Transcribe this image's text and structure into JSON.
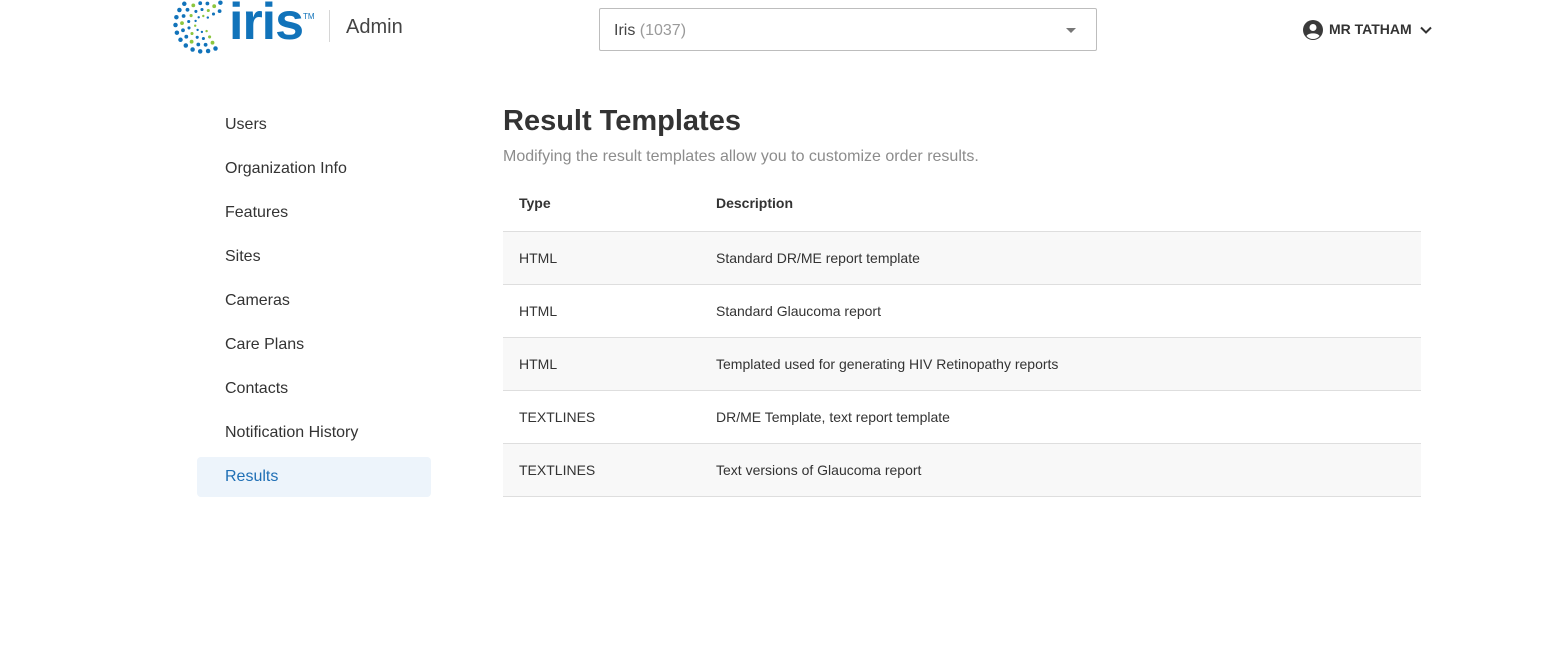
{
  "header": {
    "logo_text": "iris",
    "logo_tm": "TM",
    "section": "Admin",
    "org_selector": {
      "name": "Iris",
      "count": "(1037)"
    },
    "user": {
      "name": "MR TATHAM",
      "icon": "account-circle-icon"
    },
    "colors": {
      "brand_blue": "#1173ba",
      "brand_green": "#8cc63f"
    }
  },
  "sidebar": {
    "items": [
      {
        "label": "Users",
        "active": false
      },
      {
        "label": "Organization Info",
        "active": false
      },
      {
        "label": "Features",
        "active": false
      },
      {
        "label": "Sites",
        "active": false
      },
      {
        "label": "Cameras",
        "active": false
      },
      {
        "label": "Care Plans",
        "active": false
      },
      {
        "label": "Contacts",
        "active": false
      },
      {
        "label": "Notification History",
        "active": false
      },
      {
        "label": "Results",
        "active": true
      }
    ],
    "active_color": "#1f6fb5",
    "active_bg": "#edf4fb"
  },
  "main": {
    "title": "Result Templates",
    "subtitle": "Modifying the result templates allow you to customize order results.",
    "table": {
      "columns": [
        "Type",
        "Description"
      ],
      "rows": [
        [
          "HTML",
          "Standard DR/ME report template"
        ],
        [
          "HTML",
          "Standard Glaucoma report"
        ],
        [
          "HTML",
          "Templated used for generating HIV Retinopathy reports"
        ],
        [
          "TEXTLINES",
          "DR/ME Template, text report template"
        ],
        [
          "TEXTLINES",
          "Text versions of Glaucoma report"
        ]
      ]
    }
  }
}
